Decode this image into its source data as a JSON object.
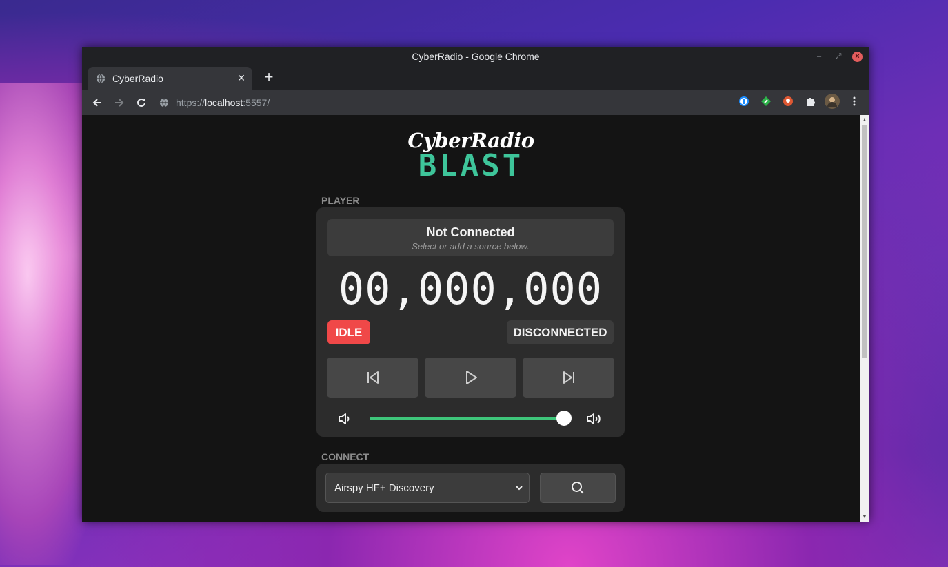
{
  "window": {
    "title": "CyberRadio - Google Chrome",
    "controls": {
      "minimize": "–",
      "restore": "⤢",
      "close": "×"
    }
  },
  "tabs": [
    {
      "label": "CyberRadio",
      "icon": "globe-icon",
      "close": "✕"
    }
  ],
  "new_tab_label": "+",
  "address_bar": {
    "scheme": "https://",
    "host": "localhost",
    "port": ":5557/"
  },
  "extensions": [
    "1password-icon",
    "green-extension-icon",
    "duckduckgo-icon",
    "puzzle-icon",
    "profile-avatar"
  ],
  "app": {
    "logo_top": "CyberRadio",
    "logo_bottom": "BLAST",
    "player": {
      "section_label": "PLAYER",
      "status_title": "Not Connected",
      "status_subtitle": "Select or add a source below.",
      "frequency": "00,000,000",
      "state_badge": "IDLE",
      "connection_badge": "DISCONNECTED",
      "volume_level": 0.98
    },
    "connect": {
      "section_label": "CONNECT",
      "device_selected": "Airspy HF+ Discovery"
    }
  },
  "colors": {
    "accent": "#3ec59a",
    "slider": "#3ec57a",
    "idle": "#f04848",
    "card": "#2c2c2c",
    "page_bg": "#141414"
  }
}
